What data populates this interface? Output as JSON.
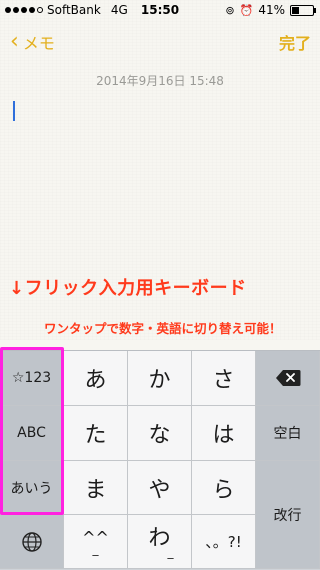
{
  "status_bar": {
    "carrier": "SoftBank",
    "network": "4G",
    "time": "15:50",
    "battery": "41%",
    "battery_level": 0.41,
    "signal_bars": 4
  },
  "nav": {
    "back_label": "メモ",
    "done_label": "完了"
  },
  "note": {
    "date": "2014年9月16日 15:48"
  },
  "annotations": {
    "title": "↓フリック入力用キーボード",
    "subtitle": "ワンタップで数字・英語に切り替え可能！"
  },
  "keyboard": {
    "mode_keys": [
      "☆123",
      "ABC",
      "あいう"
    ],
    "globe_key": "globe-icon",
    "kana_rows": [
      [
        "あ",
        "か",
        "さ"
      ],
      [
        "た",
        "な",
        "は"
      ],
      [
        "ま",
        "や",
        "ら"
      ],
      [
        "^^",
        "わ",
        "、。?!"
      ]
    ],
    "kana_row4_left_sub": "_",
    "kana_row4_mid_sub": "_",
    "space_label": "空白",
    "return_label": "改行",
    "delete_icon": "backspace-icon"
  },
  "colors": {
    "accent": "#e3b01e",
    "annotation": "#ff3a1c",
    "highlight": "#ff22e0",
    "caret": "#2f6fdb"
  }
}
